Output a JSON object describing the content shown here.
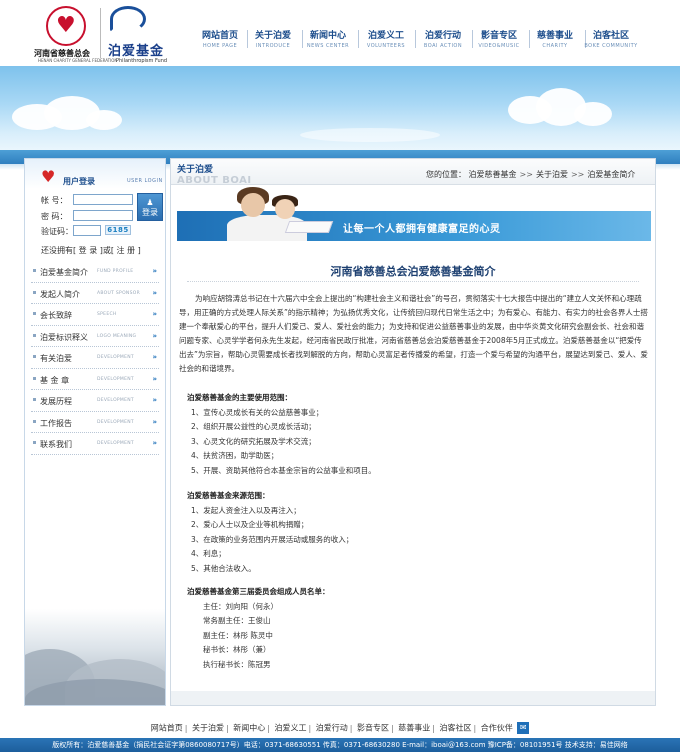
{
  "header": {
    "org_logo_text": "河南省慈善总会",
    "org_logo_sub": "HENAN CHARITY GENERAL FEDERATION",
    "fund_name": "泊爱基金",
    "fund_en": "Philanthropism Fund",
    "nav": [
      {
        "zh": "网站首页",
        "en": "HOME PAGE"
      },
      {
        "zh": "关于泊爱",
        "en": "INTRODUCE"
      },
      {
        "zh": "新闻中心",
        "en": "NEWS CENTER"
      },
      {
        "zh": "泊爱义工",
        "en": "VOLUNTEERS"
      },
      {
        "zh": "泊爱行动",
        "en": "BOAI ACTION"
      },
      {
        "zh": "影音专区",
        "en": "VIDEO&MUSIC"
      },
      {
        "zh": "慈善事业",
        "en": "CHARITY"
      },
      {
        "zh": "泊客社区",
        "en": "BOKE COMMUNITY"
      }
    ]
  },
  "login": {
    "title": "用户登录",
    "title_en": "USER LOGIN",
    "account_label": "帐  号：",
    "password_label": "密  码：",
    "captcha_label": "验证码：",
    "captcha_code": "6185",
    "login_button": "登录",
    "reg_prefix": "还没拥有",
    "reg_link": "[ 登 录 ]",
    "reg_mid": "或",
    "reg_link2": "[ 注 册 ]"
  },
  "menu": [
    {
      "zh": "泊爱基金简介",
      "en": "FUND PROFILE"
    },
    {
      "zh": "发起人简介",
      "en": "ABOUT SPONSOR"
    },
    {
      "zh": "会长致辞",
      "en": "SPEECH"
    },
    {
      "zh": "泊爱标识释义",
      "en": "LOGO MEANING"
    },
    {
      "zh": "有关泊爱",
      "en": "DEVELOPMENT"
    },
    {
      "zh": "基 金 章",
      "en": "DEVELOPMENT"
    },
    {
      "zh": "发展历程",
      "en": "DEVELOPMENT"
    },
    {
      "zh": "工作报告",
      "en": "DEVELOPMENT"
    },
    {
      "zh": "联系我们",
      "en": "DEVELOPMENT"
    }
  ],
  "main": {
    "section_title": "关于泊爱",
    "section_en": "ABOUT BOAI",
    "breadcrumb": [
      "您的位置：",
      "泊爱慈善基金",
      "关于泊爱",
      "泊爱基金简介"
    ],
    "slogan": "让每一个人都拥有健康富足的心灵",
    "article_title": "河南省慈善总会泊爱慈善基金简介",
    "intro": "为响应胡锦涛总书记在十六届六中全会上提出的“构建社会主义和谐社会”的号召，贯彻落实十七大报告中提出的“建立人文关怀和心理疏导，用正确的方式处理人际关系”的指示精神；为弘扬优秀文化，让传统回归现代日常生活之中；为有爱心、有能力、有实力的社会各界人士搭建一个奉献爱心的平台，提升人们爱己、爱人、爱社会的能力；为支持和促进公益慈善事业的发展，由中华炎黄文化研究会副会长、社会和谐问题专家、心灵学学者何永先生发起，经河南省民政厅批准，河南省慈善总会泊爱慈善基金于2008年5月正式成立。泊爱慈善基金以“把爱传出去”为宗旨，帮助心灵需要成长者找到解脱的方向，帮助心灵富足者传播爱的希望，打造一个爱与希望的沟通平台，展望达到爱己、爱人、爱社会的和谐境界。",
    "usage_title": "泊爱慈善基金的主要使用范围：",
    "usage": [
      "1、宣传心灵成长有关的公益慈善事业；",
      "2、组织开展公益性的心灵成长活动；",
      "3、心灵文化的研究拓展及学术交流；",
      "4、扶贫济困，助学助医；",
      "5、开展、资助其他符合本基金宗旨的公益事业和项目。"
    ],
    "source_title": "泊爱慈善基金来源范围：",
    "source": [
      "1、发起人资金注入以及再注入；",
      "2、爱心人士以及企业等机构捐赠；",
      "3、在政策的业务范围内开展活动或服务的收入；",
      "4、利息；",
      "5、其他合法收入。"
    ],
    "committee_title": "泊爱慈善基金第三届委员会组成人员名单：",
    "committee": [
      "主任：刘向阳（何永）",
      "常务副主任：王俊山",
      "副主任：林彤  陈灵中",
      "秘书长：林彤（兼）",
      "执行秘书长：陈冠男"
    ]
  },
  "footer": {
    "links": [
      "网站首页",
      "关于泊爱",
      "新闻中心",
      "泊爱义工",
      "泊爱行动",
      "影音专区",
      "慈善事业",
      "泊客社区",
      "合作伙伴"
    ],
    "copyright": "版权所有：泊爱慈善基金（捐民社会证字第0860080717号）电话：0371-68630551 传真：0371-68630280 E-mail：iboai@163.com 豫ICP备：08101951号 技术支持：易佳网络"
  },
  "colors": {
    "brand_blue": "#1c4d8c",
    "accent_red": "#c8102e",
    "banner_sky": "#7ec2ec"
  }
}
